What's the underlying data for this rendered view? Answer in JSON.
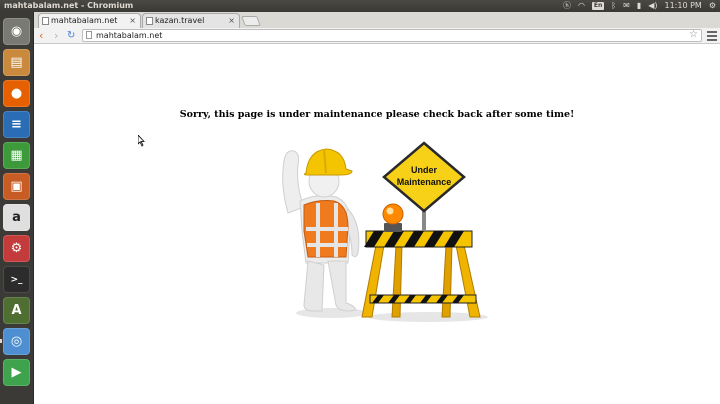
{
  "top_panel": {
    "window_title": "mahtabalam.net - Chromium",
    "clock": "11:10 PM",
    "language": "En",
    "icons": [
      "hp-icon",
      "wifi-icon",
      "keyboard-language-icon",
      "bluetooth-icon",
      "mail-icon",
      "battery-icon",
      "volume-icon",
      "session-gear-icon"
    ]
  },
  "launcher": {
    "items": [
      {
        "name": "dash-home",
        "glyph": "◉",
        "color": "#7a7a75"
      },
      {
        "name": "files",
        "glyph": "▤",
        "color": "#c98a3d"
      },
      {
        "name": "firefox",
        "glyph": "●",
        "color": "#e66000"
      },
      {
        "name": "libreoffice-writer",
        "glyph": "≡",
        "color": "#2a6db5"
      },
      {
        "name": "libreoffice-calc",
        "glyph": "▦",
        "color": "#3c9a3a"
      },
      {
        "name": "libreoffice-impress",
        "glyph": "▣",
        "color": "#c75c24"
      },
      {
        "name": "amazon",
        "glyph": "a",
        "color": "#dfdfdf"
      },
      {
        "name": "system-settings",
        "glyph": "⚙",
        "color": "#c33b3b"
      },
      {
        "name": "terminal",
        "glyph": ">_",
        "color": "#2c2c2c"
      },
      {
        "name": "app-a",
        "glyph": "A",
        "color": "#4f6e32"
      },
      {
        "name": "chromium",
        "glyph": "◎",
        "color": "#4d8fd0"
      },
      {
        "name": "youtube-app",
        "glyph": "▶",
        "color": "#3fa34d"
      }
    ]
  },
  "browser": {
    "tabs": [
      {
        "title": "mahtabalam.net",
        "active": true
      },
      {
        "title": "kazan.travel",
        "active": false
      }
    ],
    "url": "mahtabalam.net"
  },
  "page": {
    "message": "Sorry, this page is under maintenance please check back after some time!",
    "sign_line1": "Under",
    "sign_line2": "Maintenance"
  },
  "colors": {
    "hardhat": "#f5c400",
    "vest": "#f07a1e",
    "sign": "#f7d117",
    "beacon": "#ff8a00"
  }
}
